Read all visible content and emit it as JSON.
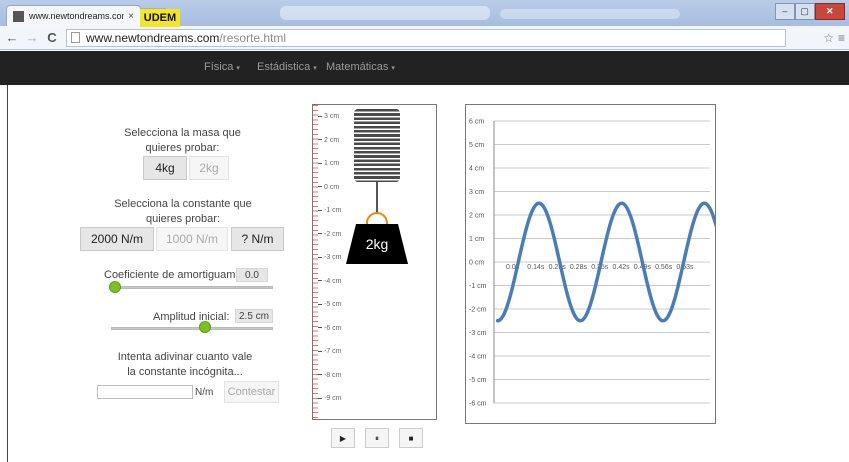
{
  "browser": {
    "tab_title": "www.newtondreams.com",
    "tab_close": "×",
    "url_host": "www.newtondreams.com",
    "url_path": "/resorte.html",
    "back": "←",
    "forward": "→",
    "reload": "C",
    "star": "☆",
    "menu": "≡",
    "window_buttons": [
      "–",
      "▢",
      "✕"
    ]
  },
  "navbar": {
    "brand": "UDEM",
    "links": [
      "Física",
      "Estádistica",
      "Matemáticas"
    ],
    "caret": "▾"
  },
  "controls": {
    "mass_prompt": "Selecciona la masa que quieres probar:",
    "mass_options": [
      "4kg",
      "2kg"
    ],
    "mass_selected": "2kg",
    "constant_prompt": "Selecciona la constante que quieres probar:",
    "constant_options": [
      "2000 N/m",
      "1000 N/m",
      "? N/m"
    ],
    "constant_selected": "1000 N/m",
    "damping_label": "Coeficiente de amortiguamiento:",
    "damping_value": "0.0",
    "damping_level": 0,
    "amplitude_label": "Amplitud inicial:",
    "amplitude_value": "2.5 cm",
    "amplitude_level": 0.6,
    "guess_prompt": "Intenta adivinar cuanto vale la constante incógnita...",
    "guess_value": "",
    "guess_unit": "N/m",
    "submit_label": "Contestar"
  },
  "spring": {
    "ruler_labels": [
      "3 cm",
      "2 cm",
      "1 cm",
      "0 cm",
      "-1 cm",
      "-2 cm",
      "-3 cm",
      "-4 cm",
      "-5 cm",
      "-6 cm",
      "-7 cm",
      "-8 cm",
      "-9 cm"
    ],
    "weight_label": "2kg"
  },
  "playback": {
    "play": "▶",
    "pause": "⏸",
    "stop": "■"
  },
  "graph": {
    "y_labels": [
      "6 cm",
      "5 cm",
      "4 cm",
      "3 cm",
      "2 cm",
      "1 cm",
      "0 cm",
      "-1 cm",
      "-2 cm",
      "-3 cm",
      "-4 cm",
      "-5 cm",
      "-6 cm"
    ],
    "x_labels": [
      "0.0s",
      "0.14s",
      "0.28s",
      "0.28s",
      "0.35s",
      "0.42s",
      "0.49s",
      "0.56s",
      "0.63s"
    ],
    "line_color": "#4a7db5",
    "amplitude_cm": 2.5,
    "period_s": 0.28,
    "t_end_s": 0.73,
    "y_range_cm": [
      -6,
      6
    ]
  },
  "colors": {
    "brand": "#f2e62b",
    "slider_thumb": "#7cc025",
    "navbar": "#222222",
    "weight_handle": "#e08a14"
  }
}
